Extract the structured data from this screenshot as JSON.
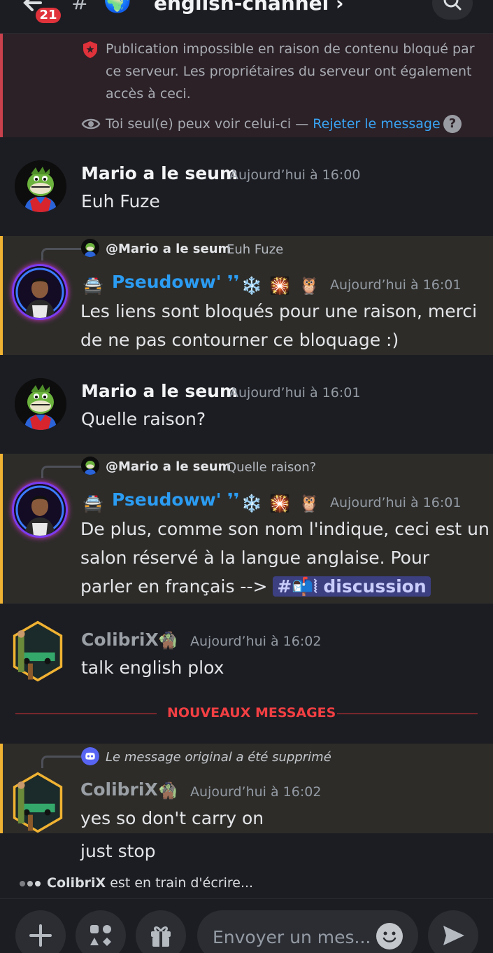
{
  "header": {
    "badge_count": "21",
    "hash": "#",
    "channel_name": "english-channel ›"
  },
  "blocked_notice": {
    "text": "Publication impossible en raison de contenu bloqué par ce serveur. Les propriétaires du serveur ont également accès à ceci.",
    "only_you": "Toi seul(e) peux voir celui-ci — ",
    "dismiss": "Rejeter le message",
    "help": "?"
  },
  "messages": [
    {
      "author": "Mario a le seum",
      "timestamp": "Aujourd’hui à 16:00",
      "lines": [
        "Euh Fuze"
      ]
    },
    {
      "reply_author": "@Mario a le seum",
      "reply_text": "Euh Fuze",
      "author": "Pseudoww' ❜❜",
      "timestamp": "Aujourd’hui à 16:01",
      "lines": [
        "Les liens sont bloqués pour une raison, merci",
        "de ne pas contourner ce bloquage :)"
      ]
    },
    {
      "author": "Mario a le seum",
      "timestamp": "Aujourd’hui à 16:01",
      "lines": [
        "Quelle raison?"
      ]
    },
    {
      "reply_author": "@Mario a le seum",
      "reply_text": "Quelle raison?",
      "author": "Pseudoww' ❜❜",
      "timestamp": "Aujourd’hui à 16:01",
      "lines": [
        "De plus, comme son nom l'indique, ceci est un",
        "salon réservé à la langue anglaise. Pour",
        "parler en français -->"
      ],
      "channel_mention": "#📬⦚ discussion"
    },
    {
      "author": "ColibriX",
      "timestamp": "Aujourd’hui à 16:02",
      "lines": [
        "talk english plox"
      ]
    },
    {
      "reply_deleted": "Le message original a été supprimé",
      "author": "ColibriX",
      "timestamp": "Aujourd’hui à 16:02",
      "lines": [
        "yes so don't carry on",
        "just stop"
      ]
    }
  ],
  "divider": "NOUVEAUX MESSAGES",
  "typing": {
    "user": "ColibriX",
    "text": " est en train d'écrire..."
  },
  "composer": {
    "placeholder": "Envoyer un mes..."
  },
  "colors": {
    "accent_highlight": "#f0b232",
    "new_messages": "#f23f43",
    "link": "#3aa4f5",
    "pseudoww_name": "#2b9cf2",
    "colibrix_name": "#9aa0a6"
  }
}
